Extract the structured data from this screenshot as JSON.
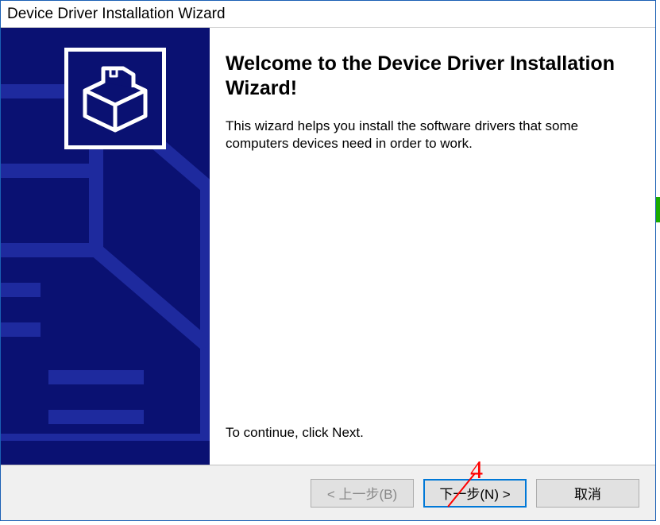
{
  "title": "Device Driver Installation Wizard",
  "heading": "Welcome to the Device Driver Installation Wizard!",
  "description": "This wizard helps you install the software drivers that some computers devices need in order to work.",
  "continue_text": "To continue, click Next.",
  "buttons": {
    "back": "< 上一步(B)",
    "next": "下一步(N) >",
    "cancel": "取消"
  },
  "annotation": {
    "label": "4"
  }
}
